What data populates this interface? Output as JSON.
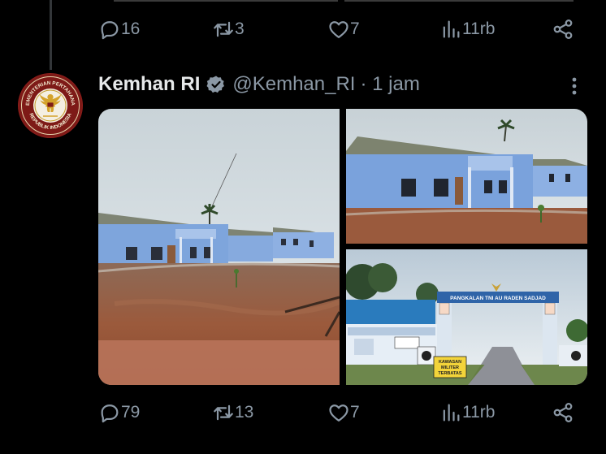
{
  "prev_tweet": {
    "actions": {
      "replies": "16",
      "reposts": "3",
      "likes": "7",
      "views": "11rb"
    }
  },
  "tweet": {
    "author_name": "Kemhan RI",
    "handle": "@Kemhan_RI",
    "time": "· 1 jam",
    "avatar_text": "KEMENTERIAN PERTAHANAN · REPUBLIK INDONESIA",
    "media": {
      "photo3_sign": "PANGKALAN TNI AU RADEN SADJAD",
      "photo3_board_top": "KAWASAN",
      "photo3_board_mid": "MILITER",
      "photo3_board_bot": "TERBATAS"
    },
    "actions": {
      "replies": "79",
      "reposts": "13",
      "likes": "7",
      "views": "11rb"
    }
  },
  "icons": [
    "reply-icon",
    "repost-icon",
    "like-icon",
    "views-icon",
    "share-icon",
    "verified-badge-icon",
    "more-icon"
  ],
  "colors": {
    "background": "#000000",
    "text_primary": "#e7e9ea",
    "text_secondary": "#8b98a5",
    "verified": "#8b98a5"
  }
}
